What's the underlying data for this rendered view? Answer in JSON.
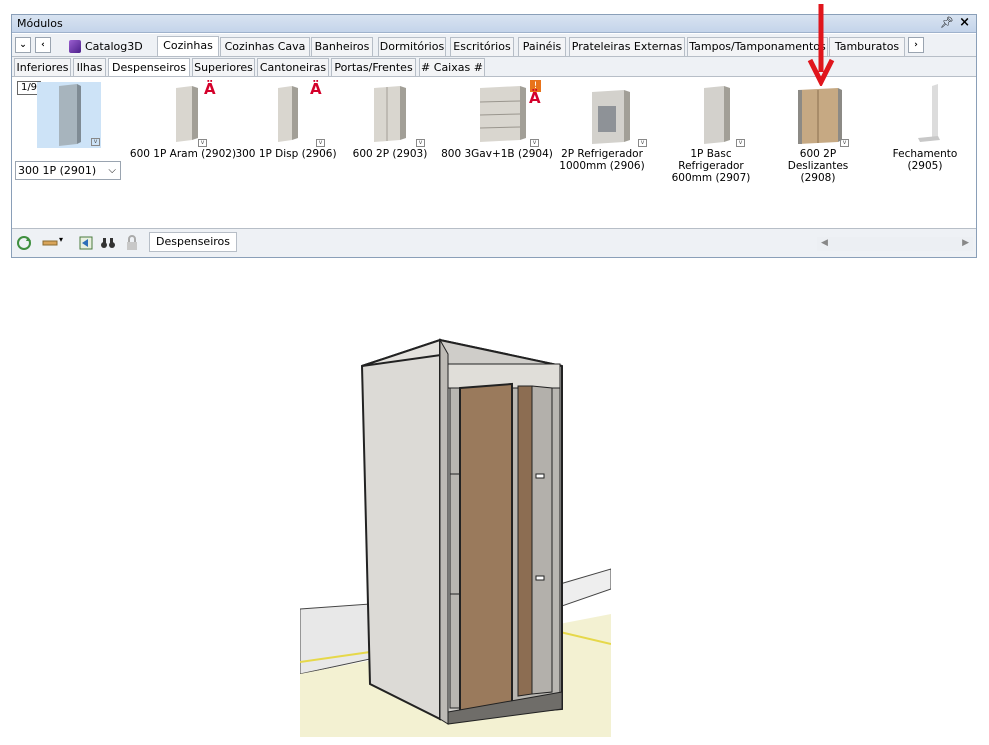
{
  "window": {
    "title": "Módulos",
    "pin_icon": "pin-icon",
    "close_icon": "close-icon"
  },
  "catalog_tabs": {
    "catalog": "Catalog3D",
    "items": [
      "Cozinhas",
      "Cozinhas Cava",
      "Banheiros",
      "Dormitórios",
      "Escritórios",
      "Painéis",
      "Prateleiras Externas",
      "Tampos/Tamponamentos",
      "Tamburatos"
    ],
    "selected": "Cozinhas"
  },
  "sub_tabs": {
    "items": [
      "Inferiores",
      "Ilhas",
      "Despenseiros",
      "Superiores",
      "Cantoneiras",
      "Portas/Frentes",
      "# Caixas #"
    ],
    "selected": "Despenseiros"
  },
  "content": {
    "pager": "1/9",
    "combo_value": "300 1P (2901)",
    "items": [
      {
        "label": "300 1P (2901)",
        "label2": ""
      },
      {
        "label": "600 1P Aram (2902)",
        "label2": ""
      },
      {
        "label": "300 1P Disp (2906)",
        "label2": ""
      },
      {
        "label": "600 2P (2903)",
        "label2": ""
      },
      {
        "label": "800 3Gav+1B (2904)",
        "label2": ""
      },
      {
        "label": "2P Refrigerador",
        "label2": "1000mm (2906)"
      },
      {
        "label": "1P Basc Refrigerador",
        "label2": "600mm (2907)"
      },
      {
        "label": "600 2P Deslizantes",
        "label2": "(2908)"
      },
      {
        "label": "Fechamento (2905)",
        "label2": ""
      }
    ]
  },
  "footer": {
    "current_category": "Despenseiros"
  },
  "colors": {
    "accent_red": "#e0151c",
    "selected_tile": "#cde3f7"
  }
}
